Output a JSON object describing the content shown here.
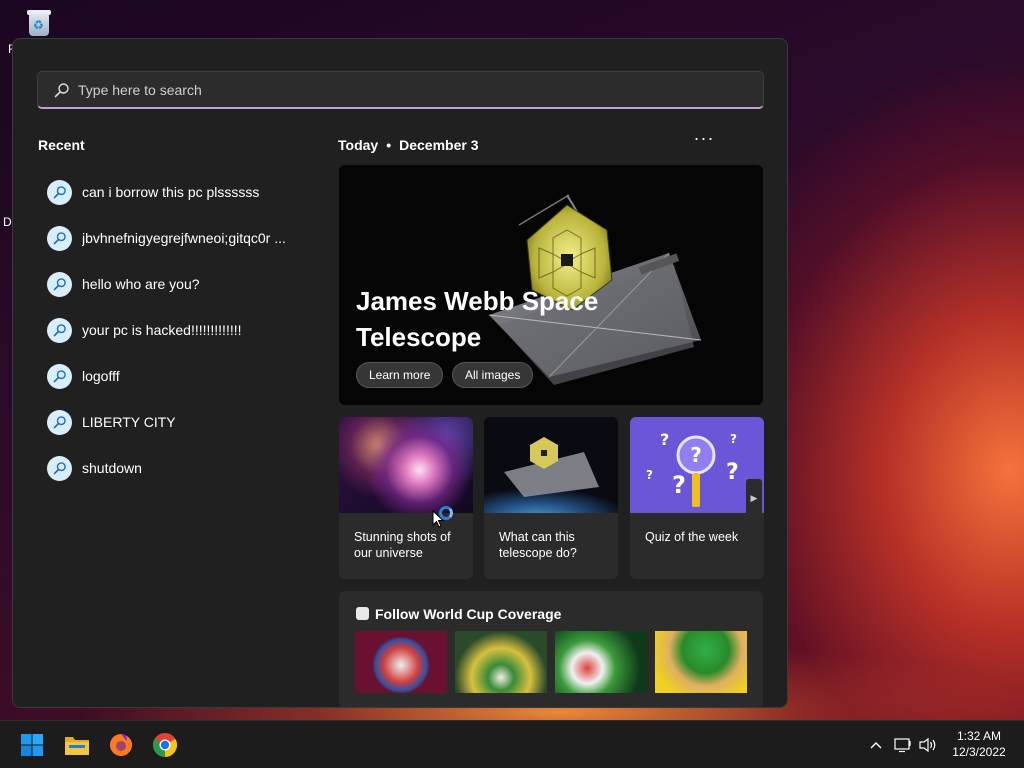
{
  "search": {
    "placeholder": "Type here to search"
  },
  "recent": {
    "title": "Recent",
    "items": [
      {
        "label": "can i borrow this pc plssssss"
      },
      {
        "label": "jbvhnefnigyegrejfwneoi;gitqc0r ..."
      },
      {
        "label": "hello who are you?"
      },
      {
        "label": "your pc is hacked!!!!!!!!!!!!!"
      },
      {
        "label": "logofff"
      },
      {
        "label": "LIBERTY CITY"
      },
      {
        "label": "shutdown"
      }
    ]
  },
  "today": {
    "label": "Today",
    "separator": "•",
    "date": "December 3",
    "more_label": "···"
  },
  "hero": {
    "title": "James Webb Space Telescope",
    "learn_more": "Learn more",
    "all_images": "All images"
  },
  "cards": [
    {
      "label": "Stunning shots of our universe"
    },
    {
      "label": "What can this telescope do?"
    },
    {
      "label": "Quiz of the week"
    }
  ],
  "worldcup": {
    "title": "Follow World Cup Coverage"
  },
  "desktop": {
    "partial_label_1": "R",
    "partial_label_2": "Da"
  },
  "taskbar": {
    "apps": [
      "start-icon",
      "file-explorer-icon",
      "firefox-icon",
      "chrome-icon"
    ],
    "time": "1:32 AM",
    "date": "12/3/2022"
  },
  "colors": {
    "search_accent": "#c79bd6",
    "panel_bg": "#202020",
    "card_bg": "#2b2b2b",
    "recent_icon_bg": "#d8eefc",
    "start_blue": "#1e9bf0"
  }
}
